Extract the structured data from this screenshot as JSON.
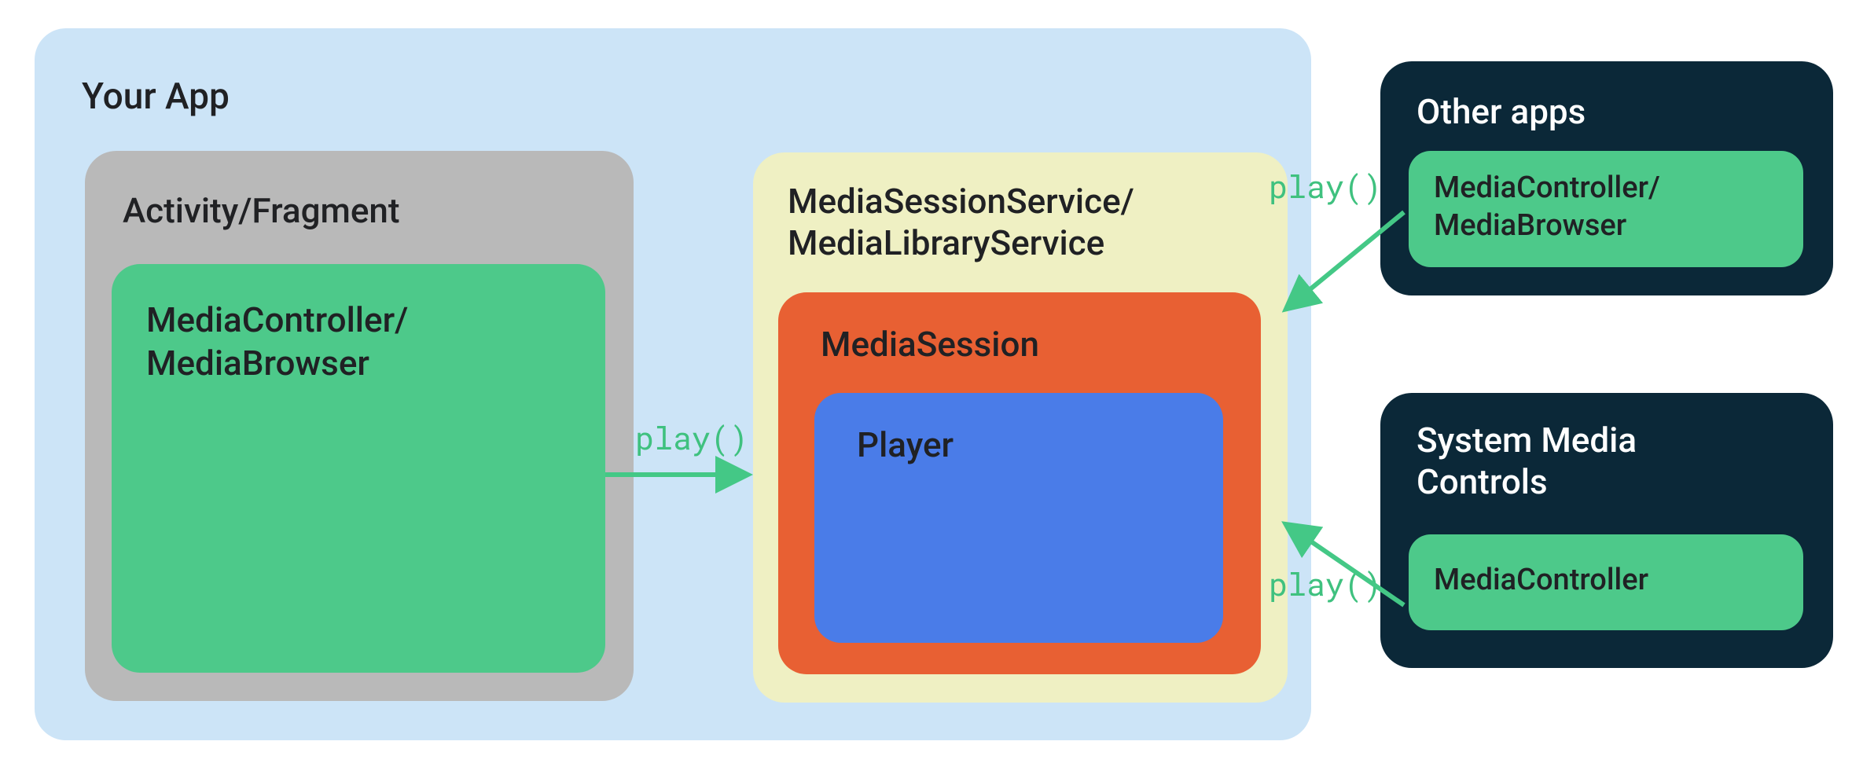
{
  "your_app": {
    "title": "Your App",
    "activity_fragment": {
      "title": "Activity/Fragment",
      "controller_browser": "MediaController/\nMediaBrowser"
    },
    "service": {
      "title": "MediaSessionService/\nMediaLibraryService",
      "media_session": "MediaSession",
      "player": "Player"
    }
  },
  "other_apps": {
    "title": "Other apps",
    "controller_browser": "MediaController/\nMediaBrowser"
  },
  "system_media_controls": {
    "title": "System Media\nControls",
    "controller": "MediaController"
  },
  "calls": {
    "play_internal": "play()",
    "play_other": "play()",
    "play_smc": "play()"
  },
  "colors": {
    "app_bg": "#cce4f7",
    "grey": "#b9b9b9",
    "green": "#4dc98a",
    "cream": "#eff0c3",
    "orange": "#e86033",
    "blue": "#4a7ce8",
    "dark": "#0b2838",
    "arrow": "#44c886"
  }
}
